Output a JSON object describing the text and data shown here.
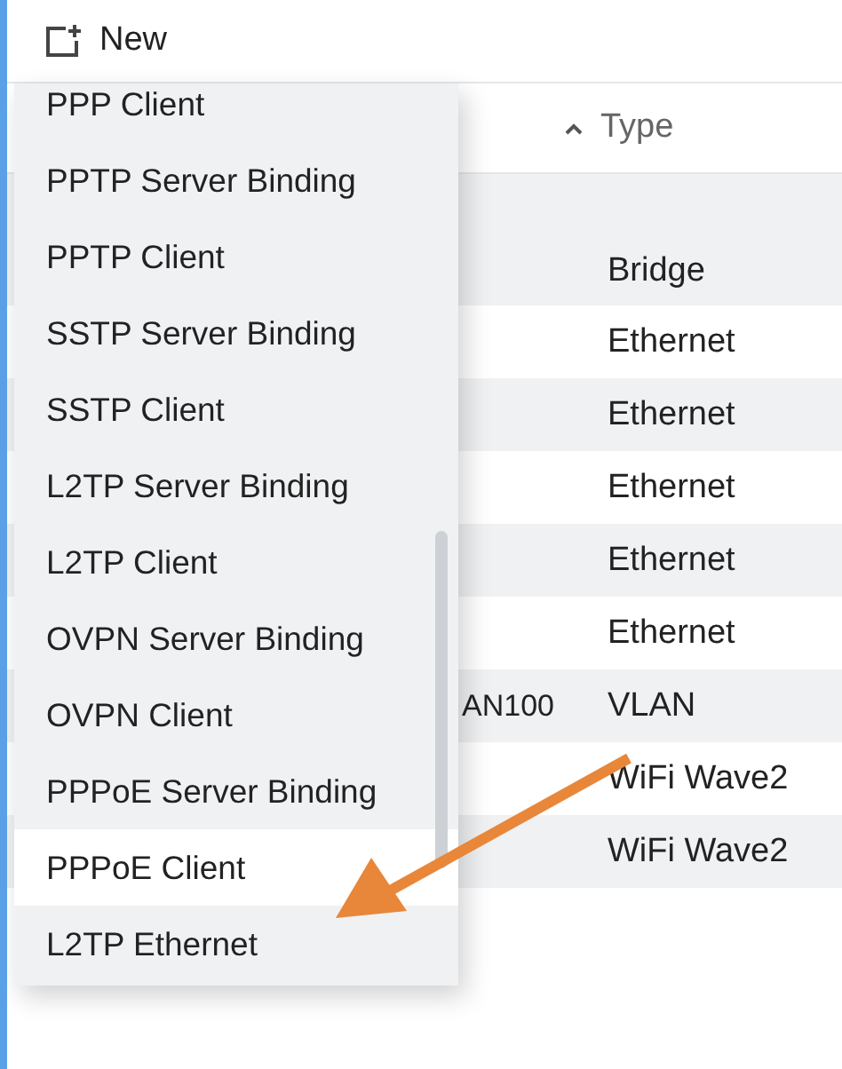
{
  "toolbar": {
    "new_button": "New"
  },
  "table": {
    "columns": [
      {
        "label": "Type"
      }
    ],
    "rows": [
      {
        "type": "Bridge",
        "shaded": true,
        "tall": true
      },
      {
        "type": "Ethernet",
        "shaded": false
      },
      {
        "type": "Ethernet",
        "shaded": true
      },
      {
        "type": "Ethernet",
        "shaded": false
      },
      {
        "type": "Ethernet",
        "shaded": true
      },
      {
        "type": "Ethernet",
        "shaded": false
      },
      {
        "name": "AN100",
        "type": "VLAN",
        "shaded": true
      },
      {
        "type": "WiFi Wave2",
        "shaded": false
      },
      {
        "type": "WiFi Wave2",
        "shaded": true
      }
    ]
  },
  "menu": {
    "items": [
      {
        "label": "PPP Client",
        "selected": false
      },
      {
        "label": "PPTP Server Binding",
        "selected": false
      },
      {
        "label": "PPTP Client",
        "selected": false
      },
      {
        "label": "SSTP Server Binding",
        "selected": false
      },
      {
        "label": "SSTP Client",
        "selected": false
      },
      {
        "label": "L2TP Server Binding",
        "selected": false
      },
      {
        "label": "L2TP Client",
        "selected": false
      },
      {
        "label": "OVPN Server Binding",
        "selected": false
      },
      {
        "label": "OVPN Client",
        "selected": false
      },
      {
        "label": "PPPoE Server Binding",
        "selected": false
      },
      {
        "label": "PPPoE Client",
        "selected": true
      },
      {
        "label": "L2TP Ethernet",
        "selected": false
      }
    ]
  }
}
